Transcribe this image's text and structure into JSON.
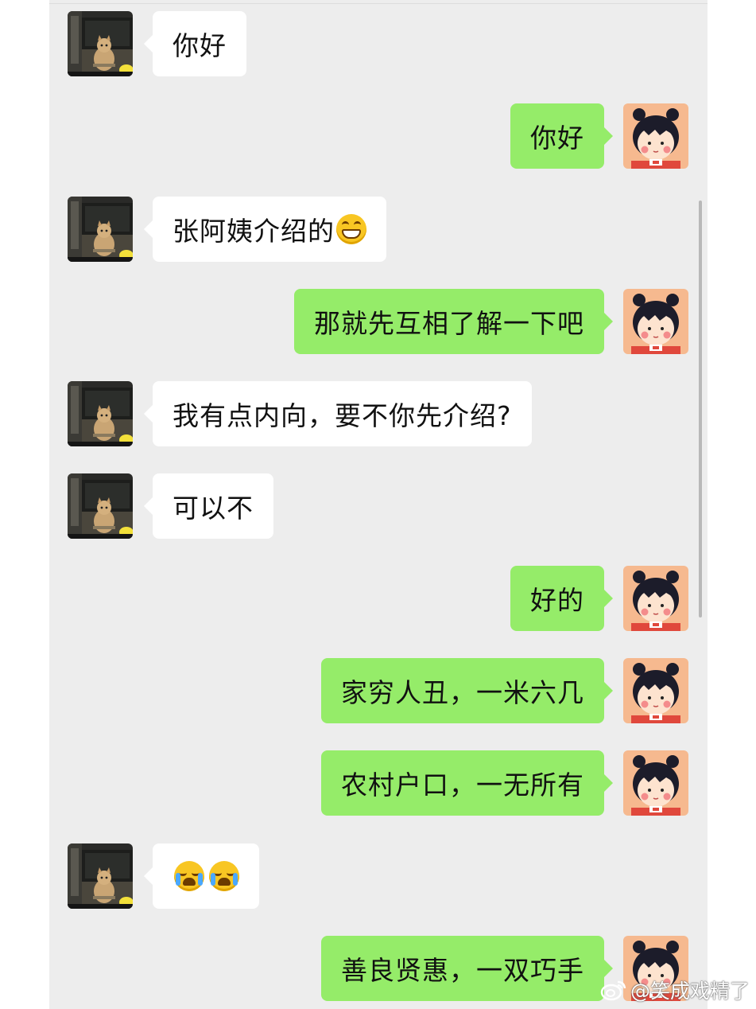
{
  "conversation": {
    "messages": [
      {
        "side": "left",
        "text": "你好"
      },
      {
        "side": "right",
        "text": "你好"
      },
      {
        "side": "left",
        "text": "张阿姨介绍的",
        "emoji": "grinning-face"
      },
      {
        "side": "right",
        "text": "那就先互相了解一下吧"
      },
      {
        "side": "left",
        "text": "我有点内向，要不你先介绍?"
      },
      {
        "side": "left",
        "text": "可以不"
      },
      {
        "side": "right",
        "text": "好的"
      },
      {
        "side": "right",
        "text": "家穷人丑，一米六几"
      },
      {
        "side": "right",
        "text": "农村户口，一无所有"
      },
      {
        "side": "left",
        "text": "",
        "emoji": "crying-laughing-face x2"
      },
      {
        "side": "right",
        "text": "善良贤惠，一双巧手"
      }
    ]
  },
  "avatars": {
    "contact": "cat-photo-avatar",
    "self": "cartoon-girl-avatar"
  },
  "colors": {
    "background": "#ededed",
    "bubble_self": "#95ec69",
    "bubble_contact": "#ffffff"
  },
  "watermark": {
    "icon": "weibo-icon",
    "text": "@笑成戏精了"
  }
}
